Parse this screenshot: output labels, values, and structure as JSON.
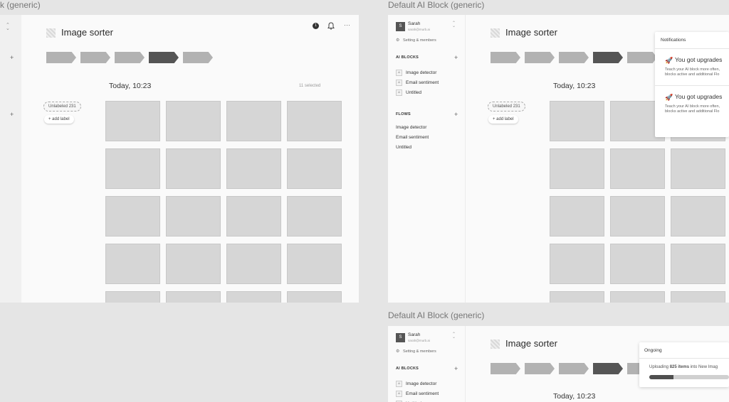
{
  "frame_labels": {
    "left": "k (generic)",
    "right_top": "Default AI Block (generic)",
    "right_bottom": "Default AI Block (generic)"
  },
  "left_frame": {
    "title": "Image sorter",
    "notification_count": "1",
    "datetime": "Today, 10:23",
    "selected_text": "11 selected",
    "label_pill": "Unlabeled  231",
    "add_label": "+ add label",
    "rail_plus": "+",
    "more_icon": "···"
  },
  "sidebar": {
    "user_name": "Sarah",
    "user_email": "sarah@murb.ai",
    "avatar_letter": "S",
    "settings_label": "Setting & members",
    "ai_blocks_heading": "AI BLOCKS",
    "ai_blocks": [
      "Image detector",
      "Email sentiment",
      "Untitled"
    ],
    "flows_heading": "FLOWS",
    "flows": [
      "Image detector",
      "Email sentiment",
      "Untitled"
    ],
    "plus": "+",
    "block_icon": "Ai"
  },
  "right_top": {
    "title": "Image sorter",
    "datetime": "Today, 10:23",
    "label_pill": "Unlabeled  231",
    "add_label": "+ add label"
  },
  "notifications": {
    "title": "Notifications",
    "items": [
      {
        "title": "You got upgrades",
        "line1": "Teach your AI block more often,",
        "line2": "blocks active and additional Flo"
      },
      {
        "title": "You got upgrades",
        "line1": "Teach your AI block more often,",
        "line2": "blocks active and additional Flo"
      }
    ]
  },
  "right_bottom": {
    "title": "Image sorter",
    "datetime": "Today, 10:23"
  },
  "ongoing": {
    "title": "Ongoing",
    "text_prefix": "Uploading ",
    "text_count": "825 items",
    "text_suffix": " into New Imag",
    "progress_fraction": 0.3
  },
  "colors": {
    "step_active": "#555555",
    "step_inactive": "#b2b2b2",
    "tile": "#d6d6d6"
  }
}
